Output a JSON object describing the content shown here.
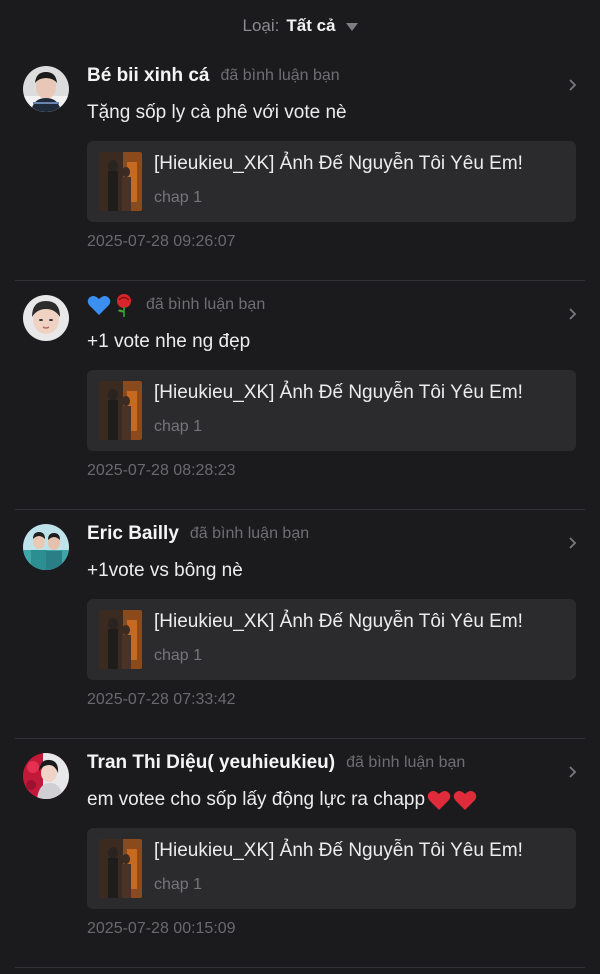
{
  "filter": {
    "label": "Loại:",
    "value": "Tất cả"
  },
  "notifications": [
    {
      "username": "Bé bii xinh cá",
      "action": "đã bình luận bạn",
      "comment": "Tặng sốp ly cà phê với vote nè",
      "work_title": "[Hieukieu_XK] Ảnh Đế Nguyễn Tôi Yêu Em!",
      "chapter": "chap 1",
      "time": "2025-07-28 09:26:07"
    },
    {
      "username": "",
      "username_icons": [
        "blue-heart-emoji",
        "rose-emoji"
      ],
      "action": "đã bình luận bạn",
      "comment": "+1 vote nhe ng đẹp",
      "work_title": "[Hieukieu_XK] Ảnh Đế Nguyễn Tôi Yêu Em!",
      "chapter": "chap 1",
      "time": "2025-07-28 08:28:23"
    },
    {
      "username": "Eric Bailly",
      "action": "đã bình luận bạn",
      "comment": "+1vote vs bông nè",
      "work_title": "[Hieukieu_XK] Ảnh Đế Nguyễn Tôi Yêu Em!",
      "chapter": "chap 1",
      "time": "2025-07-28 07:33:42"
    },
    {
      "username": "Tran Thi Diệu( yeuhieukieu)",
      "action": "đã bình luận bạn",
      "comment": "em votee cho sốp lấy động lực ra chapp",
      "comment_icons": [
        "red-heart-emoji",
        "red-heart-emoji"
      ],
      "work_title": "[Hieukieu_XK] Ảnh Đế Nguyễn Tôi Yêu Em!",
      "chapter": "chap 1",
      "time": "2025-07-28 00:15:09"
    }
  ],
  "colors": {
    "background": "#1b1b1d",
    "card": "#2b2b2e",
    "divider": "#323236",
    "muted_text": "#6f6f73"
  }
}
